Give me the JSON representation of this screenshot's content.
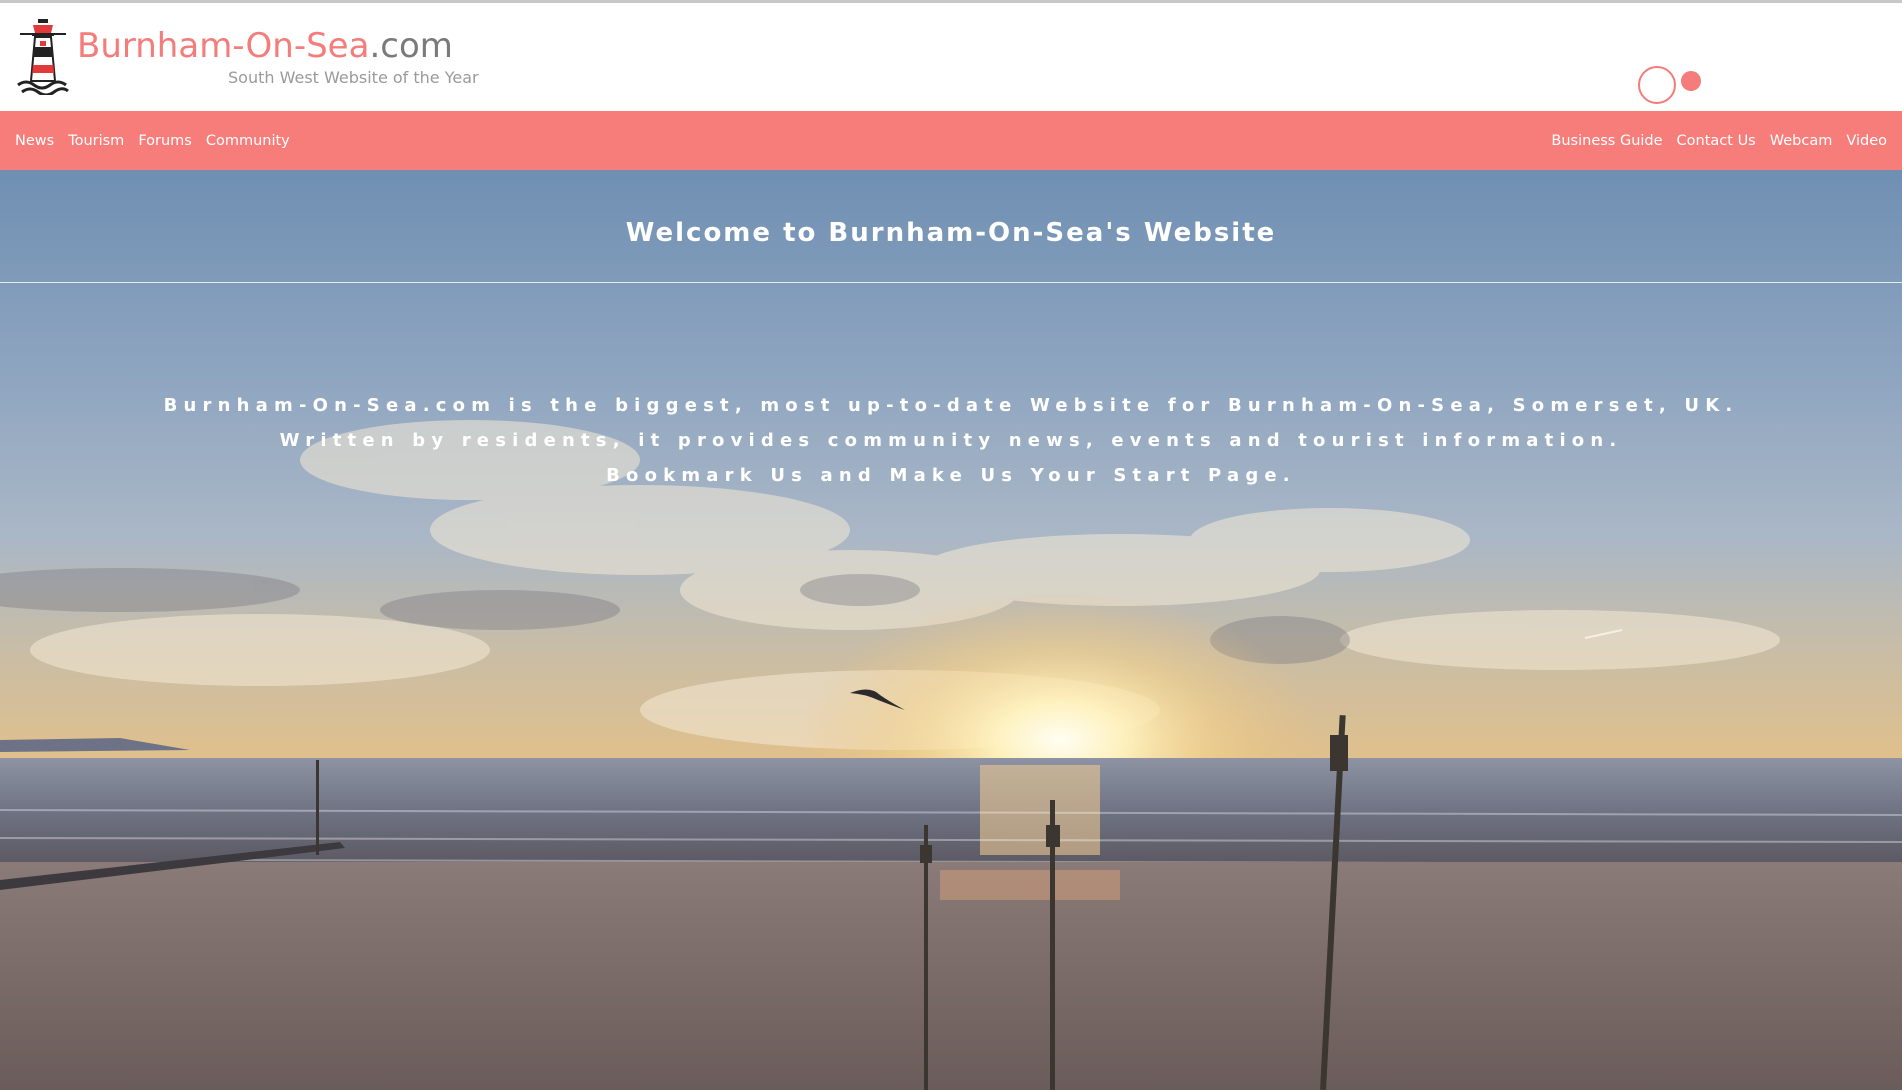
{
  "header": {
    "title_brand": "Burnham-On-Sea",
    "title_tld": ".com",
    "tagline": "South West Website of the Year"
  },
  "nav": {
    "left": [
      {
        "label": "News"
      },
      {
        "label": "Tourism"
      },
      {
        "label": "Forums"
      },
      {
        "label": "Community"
      }
    ],
    "right": [
      {
        "label": "Business Guide"
      },
      {
        "label": "Contact Us"
      },
      {
        "label": "Webcam"
      },
      {
        "label": "Video"
      }
    ]
  },
  "hero": {
    "heading": "Welcome to Burnham-On-Sea's Website",
    "lines": [
      "Burnham-On-Sea.com is the biggest, most up-to-date Website for Burnham-On-Sea, Somerset, UK.",
      "Written by residents, it provides community news, events and tourist information.",
      "Bookmark Us and Make Us Your Start Page."
    ]
  },
  "colors": {
    "accent": "#f77d7a",
    "muted": "#9a9a9a"
  }
}
